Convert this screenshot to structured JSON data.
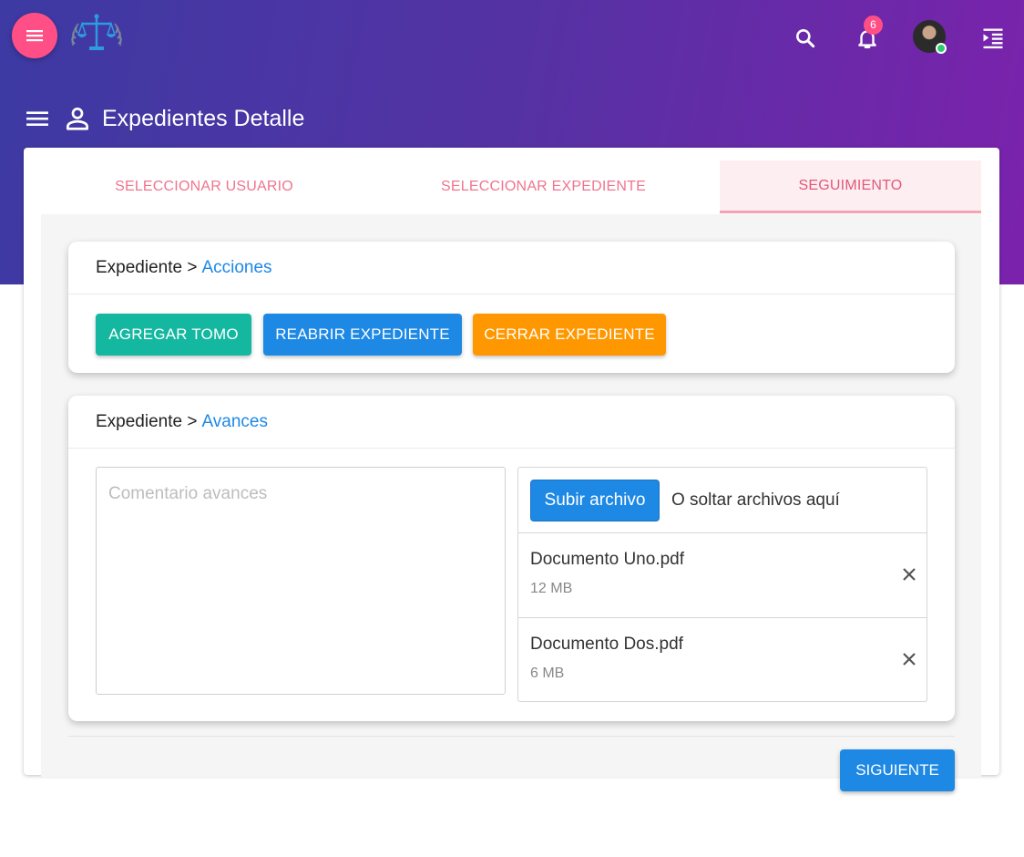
{
  "topbar": {
    "notifications_count": "6",
    "icons": [
      "menu-icon",
      "scales-of-justice-logo",
      "search-icon",
      "bell-icon",
      "avatar",
      "indent-icon"
    ]
  },
  "page": {
    "title": "Expedientes Detalle"
  },
  "tabs": [
    {
      "label": "SELECCIONAR USUARIO",
      "active": false
    },
    {
      "label": "SELECCIONAR EXPEDIENTE",
      "active": false
    },
    {
      "label": "SEGUIMIENTO",
      "active": true
    }
  ],
  "acciones": {
    "crumb_root": "Expediente >",
    "crumb_link": "Acciones",
    "buttons": {
      "agregar_tomo": "AGREGAR TOMO",
      "reabrir": "REABRIR EXPEDIENTE",
      "cerrar": "CERRAR EXPEDIENTE"
    }
  },
  "avances": {
    "crumb_root": "Expediente >",
    "crumb_link": "Avances",
    "comment_placeholder": "Comentario avances",
    "upload_button": "Subir archivo",
    "drop_text": "O soltar archivos aquí",
    "files": [
      {
        "name": "Documento Uno.pdf",
        "size": "12 MB"
      },
      {
        "name": "Documento Dos.pdf",
        "size": "6 MB"
      }
    ]
  },
  "footer": {
    "next_label": "SIGUIENTE"
  },
  "colors": {
    "accent_pink": "#ff4f86",
    "primary_blue": "#1e88e5",
    "teal": "#14b8a0",
    "orange": "#ff9800",
    "header_gradient_start": "#3d3aa3",
    "header_gradient_end": "#7b22ac"
  }
}
